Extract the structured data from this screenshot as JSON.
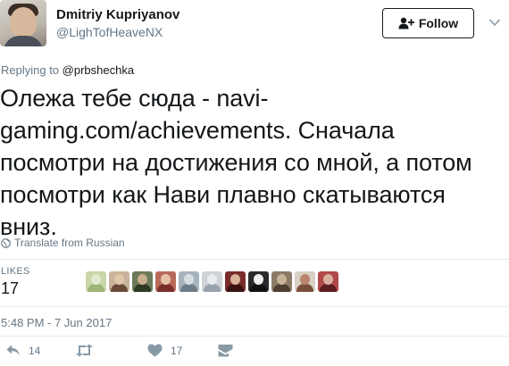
{
  "author": {
    "name": "Dmitriy Kupriyanov",
    "handle": "@LighTofHeaveNX"
  },
  "follow_button": {
    "label": "Follow"
  },
  "replying": {
    "prefix": "Replying to",
    "mention": "@prbshechka"
  },
  "tweet": {
    "text": "Олежа тебе сюда - navi-gaming.com/achievements. Сначала посмотри на достижения со мной, а потом посмотри как Нави плавно скатываются вниз."
  },
  "translate": {
    "label": "Translate from Russian"
  },
  "likes": {
    "label": "LIKES",
    "count": "17",
    "likers": [
      {
        "bg": "#c9d6a8",
        "head": "#e2ead0",
        "body": "#9fb47a"
      },
      {
        "bg": "#c8b49c",
        "head": "#e0c7a8",
        "body": "#6a4b38"
      },
      {
        "bg": "#6d7a58",
        "head": "#c9b08f",
        "body": "#2f3a24"
      },
      {
        "bg": "#b86a5a",
        "head": "#e6c2a8",
        "body": "#7a2e2a"
      },
      {
        "bg": "#a7b3bd",
        "head": "#d6dde3",
        "body": "#6f7d89"
      },
      {
        "bg": "#cfd3d8",
        "head": "#e9ecef",
        "body": "#9aa3ad"
      },
      {
        "bg": "#7a2b2b",
        "head": "#d9b39a",
        "body": "#3a1212"
      },
      {
        "bg": "#2a2a2a",
        "head": "#eeeeee",
        "body": "#111111"
      },
      {
        "bg": "#8a7a66",
        "head": "#c9b398",
        "body": "#4d3f31"
      },
      {
        "bg": "#d8d0c4",
        "head": "#b9856e",
        "body": "#7a4f3a"
      },
      {
        "bg": "#b04848",
        "head": "#d9b0a0",
        "body": "#5c1f1f"
      }
    ]
  },
  "timestamp": "5:48 PM - 7 Jun 2017",
  "actions": {
    "reply_count": "14",
    "retweet_count": "",
    "like_count": "17"
  },
  "colors": {
    "text": "#14171a",
    "secondary": "#657786",
    "divider": "#e6ecf0"
  }
}
